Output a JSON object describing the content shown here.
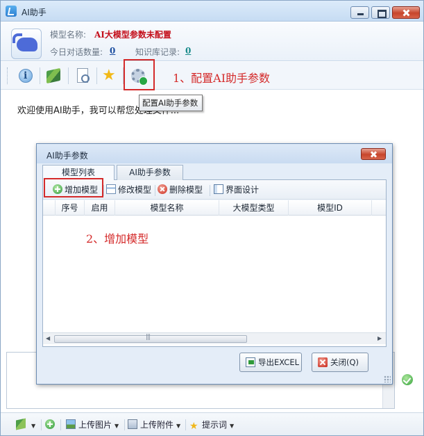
{
  "window": {
    "title": "AI助手"
  },
  "header": {
    "model_label": "模型名称:",
    "model_value": "AI大模型参数未配置",
    "chat_count_label": "今日对话数量:",
    "chat_count_value": "0",
    "kb_label": "知识库记录:",
    "kb_value": "0"
  },
  "toolbar": {
    "buttons": [
      {
        "icon": "info-icon"
      },
      {
        "icon": "knowledge-book-icon"
      },
      {
        "icon": "document-search-icon"
      },
      {
        "icon": "favorite-star-icon"
      },
      {
        "icon": "settings-gear-icon"
      }
    ],
    "tooltip": "配置AI助手参数",
    "annotation_step1": "1、配置AI助手参数"
  },
  "welcome_text": "欢迎使用AI助手，我可以帮您处理文件...",
  "bottom_bar": {
    "upload_image": "上传图片",
    "upload_attachment": "上传附件",
    "prompt_words": "提示词"
  },
  "dialog": {
    "title": "AI助手参数",
    "tabs": [
      "模型列表",
      "AI助手参数"
    ],
    "toolbar": {
      "add": "增加模型",
      "edit": "修改模型",
      "delete": "删除模型",
      "design": "界面设计"
    },
    "columns": [
      "序号",
      "启用",
      "模型名称",
      "大模型类型",
      "模型ID"
    ],
    "rows": [],
    "annotation_step2": "2、增加模型",
    "export_button": "导出EXCEL",
    "close_button": "关闭(Q)"
  },
  "colors": {
    "annotation_red": "#d42a2a",
    "model_value_red": "#c4101c",
    "link_blue": "#1d4fa0",
    "link_teal": "#188a8a"
  }
}
